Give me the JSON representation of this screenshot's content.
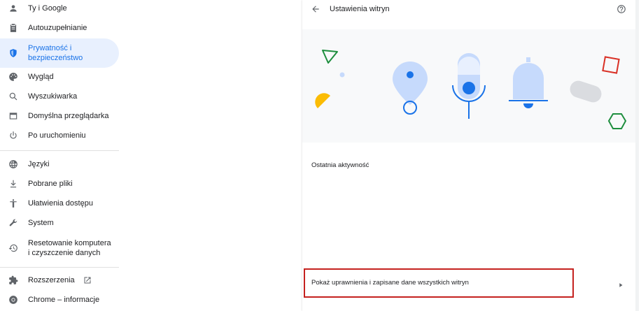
{
  "sidebar": {
    "items": [
      {
        "label": "Ty i Google"
      },
      {
        "label": "Autouzupełnianie"
      },
      {
        "label_line1": "Prywatność i",
        "label_line2": "bezpieczeństwo"
      },
      {
        "label": "Wygląd"
      },
      {
        "label": "Wyszukiwarka"
      },
      {
        "label": "Domyślna przeglądarka"
      },
      {
        "label": "Po uruchomieniu"
      },
      {
        "label": "Języki"
      },
      {
        "label": "Pobrane pliki"
      },
      {
        "label": "Ułatwienia dostępu"
      },
      {
        "label": "System"
      },
      {
        "label_line1": "Resetowanie komputera",
        "label_line2": "i czyszczenie danych"
      },
      {
        "label": "Rozszerzenia"
      },
      {
        "label": "Chrome – informacje"
      }
    ]
  },
  "header": {
    "title": "Ustawienia witryn"
  },
  "main": {
    "recent_activity_title": "Ostatnia aktywność",
    "all_sites_row_label": "Pokaż uprawnienia i zapisane dane wszystkich witryn"
  },
  "colors": {
    "accent": "#1a73e8",
    "active_bg": "#e8f0fe",
    "highlight": "#c5221f"
  }
}
